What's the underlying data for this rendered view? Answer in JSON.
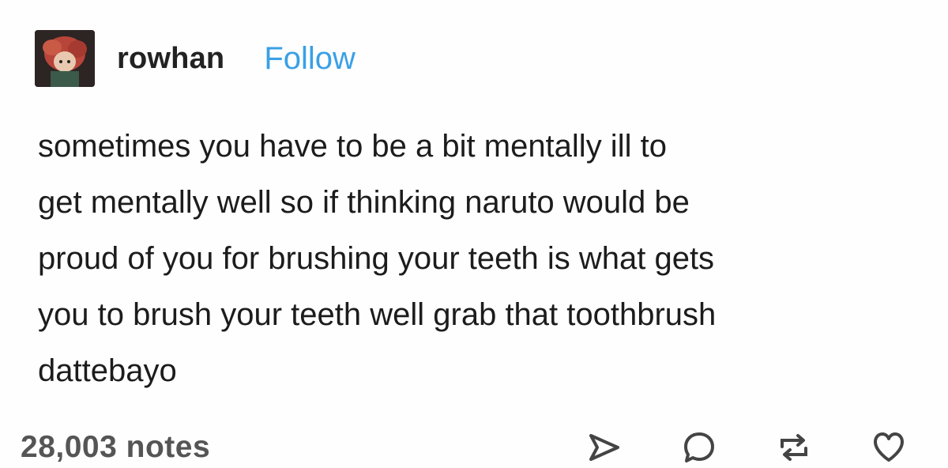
{
  "post": {
    "username": "rowhan",
    "follow_label": "Follow",
    "text": "sometimes you have to be a bit mentally ill to\nget mentally well so if thinking naruto would be\nproud of you for brushing your teeth is what gets\nyou to brush your teeth well grab that toothbrush\ndattebayo",
    "notes": "28,003 notes"
  },
  "colors": {
    "follow": "#3aa0e6",
    "text": "#1c1c1c",
    "icons": "#444444"
  },
  "icons": [
    "avatar",
    "share-icon",
    "comment-icon",
    "reblog-icon",
    "heart-icon"
  ]
}
